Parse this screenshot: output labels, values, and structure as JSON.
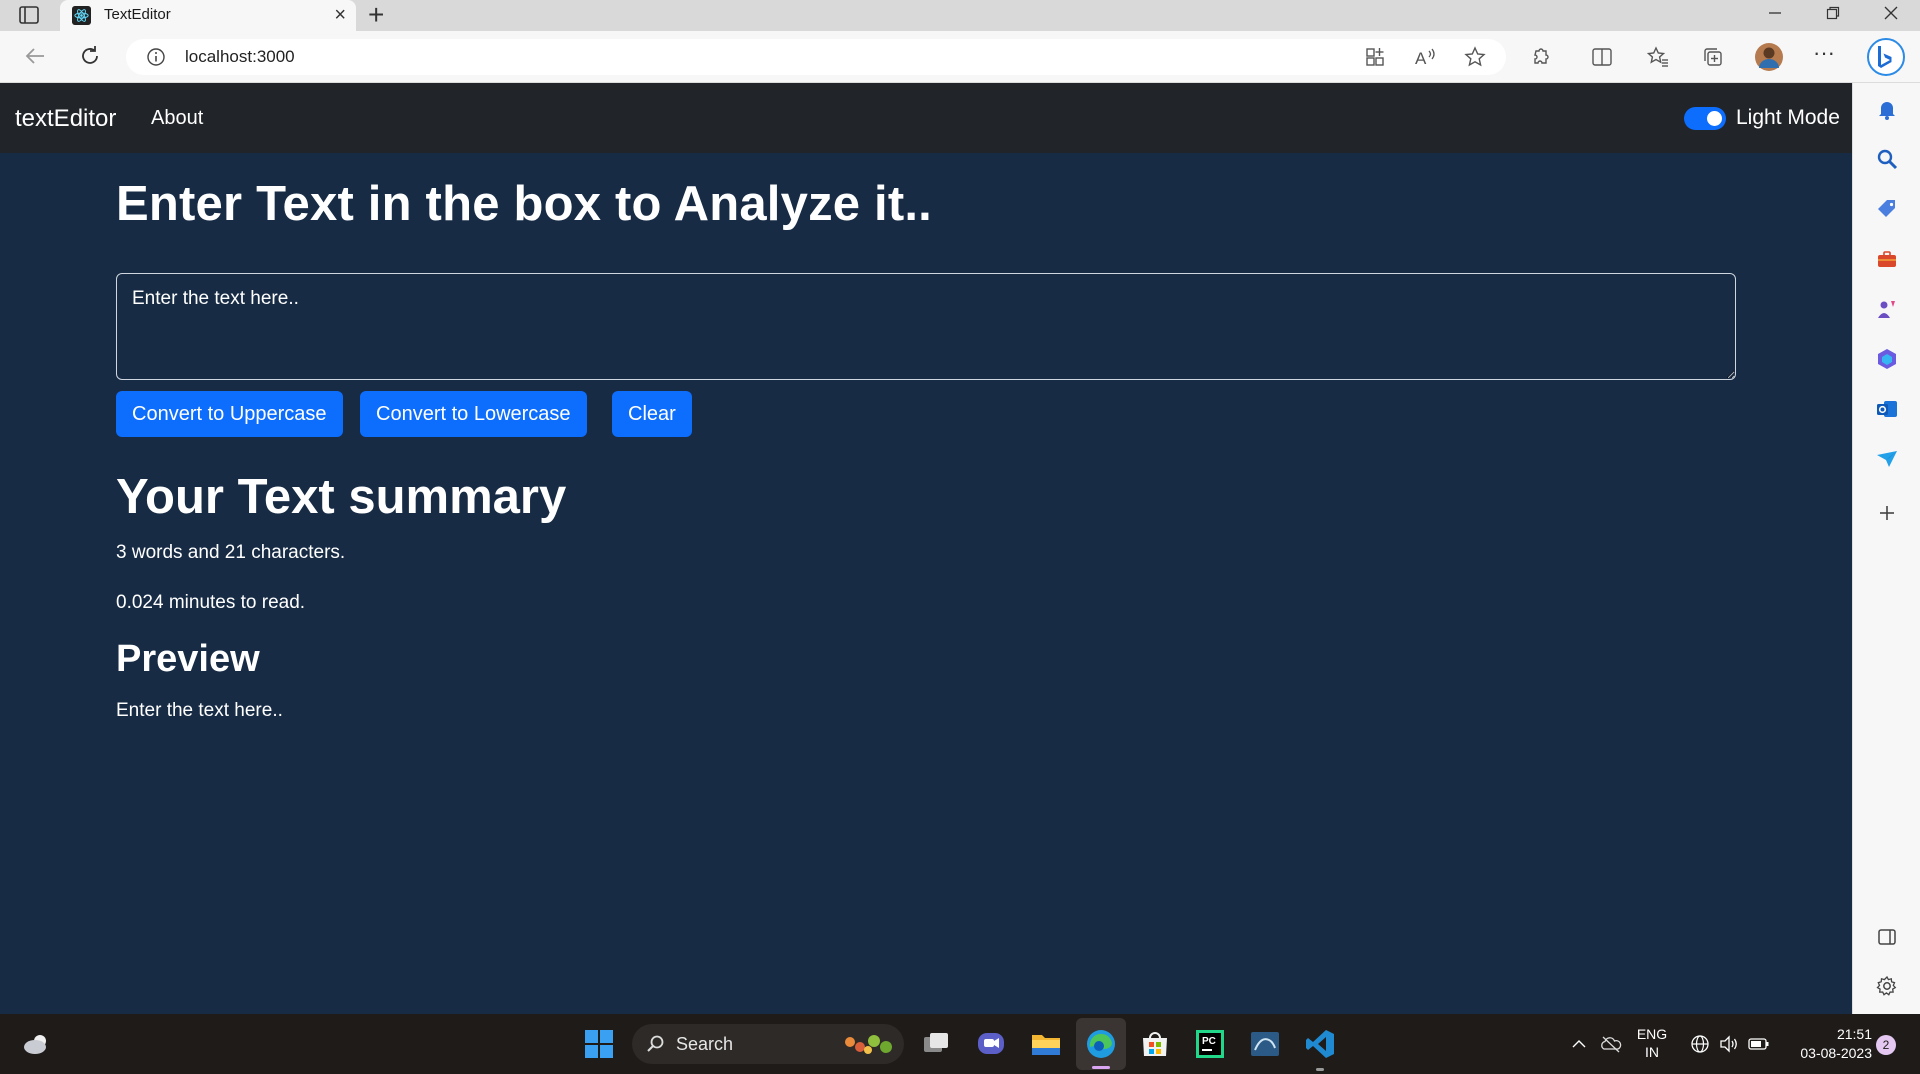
{
  "browser": {
    "tab_title": "TextEditor",
    "tab_close": "×",
    "new_tab": "+",
    "url": "localhost:3000"
  },
  "navbar": {
    "brand": "textEditor",
    "about": "About",
    "mode_label": "Light Mode",
    "mode_toggle_on": true
  },
  "main": {
    "heading": "Enter Text in the box to Analyze it..",
    "textarea_placeholder": "Enter the text here..",
    "buttons": {
      "uppercase": "Convert to Uppercase",
      "lowercase": "Convert to Lowercase",
      "clear": "Clear"
    }
  },
  "summary": {
    "heading": "Your Text summary",
    "counts": "3 words and 21 characters.",
    "read_time": "0.024 minutes to read."
  },
  "preview": {
    "heading": "Preview",
    "text": "Enter the text here.."
  },
  "taskbar": {
    "search_label": "Search",
    "lang_top": "ENG",
    "lang_bottom": "IN",
    "time": "21:51",
    "date": "03-08-2023",
    "notification_count": "2"
  },
  "colors": {
    "page_bg": "#172b45",
    "navbar_bg": "#212529",
    "accent": "#0d6efd"
  }
}
